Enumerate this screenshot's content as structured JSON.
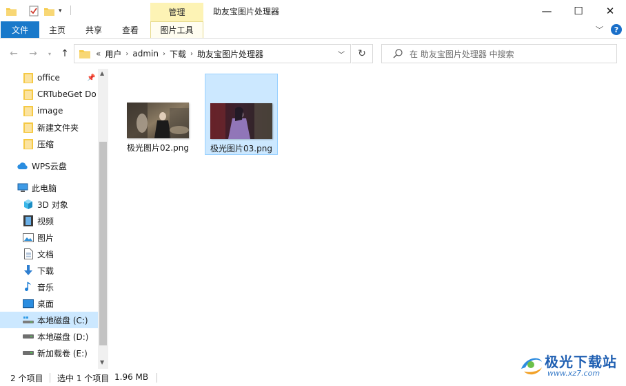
{
  "window": {
    "title": "助友宝图片处理器",
    "manage_tab": "管理",
    "controls": {
      "minimize": "—",
      "maximize": "☐",
      "close": "✕"
    }
  },
  "ribbon": {
    "tabs": [
      {
        "label": "文件"
      },
      {
        "label": "主页"
      },
      {
        "label": "共享"
      },
      {
        "label": "查看"
      },
      {
        "label": "图片工具"
      }
    ],
    "help": "?"
  },
  "address": {
    "overflow": "«",
    "crumbs": [
      "用户",
      "admin",
      "下载",
      "助友宝图片处理器"
    ],
    "separator": "›"
  },
  "search": {
    "placeholder": "在 助友宝图片处理器 中搜索"
  },
  "sidebar": {
    "quick_access": [
      {
        "label": "office",
        "icon": "folder-icon",
        "pinned": true
      },
      {
        "label": "CRTubeGet Do",
        "icon": "folder-icon"
      },
      {
        "label": "image",
        "icon": "folder-icon"
      },
      {
        "label": "新建文件夹",
        "icon": "folder-icon"
      },
      {
        "label": "压缩",
        "icon": "folder-icon"
      }
    ],
    "wps": {
      "label": "WPS云盘",
      "icon": "cloud-icon"
    },
    "this_pc": {
      "label": "此电脑",
      "icon": "computer-icon"
    },
    "pc_items": [
      {
        "label": "3D 对象",
        "icon": "cube-3d-icon"
      },
      {
        "label": "视频",
        "icon": "video-icon"
      },
      {
        "label": "图片",
        "icon": "pictures-icon"
      },
      {
        "label": "文档",
        "icon": "documents-icon"
      },
      {
        "label": "下载",
        "icon": "download-icon"
      },
      {
        "label": "音乐",
        "icon": "music-icon"
      },
      {
        "label": "桌面",
        "icon": "desktop-icon"
      },
      {
        "label": "本地磁盘 (C:)",
        "icon": "drive-c-icon",
        "selected": true
      },
      {
        "label": "本地磁盘 (D:)",
        "icon": "drive-icon"
      },
      {
        "label": "新加载卷 (E:)",
        "icon": "drive-icon"
      }
    ]
  },
  "files": [
    {
      "name": "极光图片02.png",
      "selected": false
    },
    {
      "name": "极光图片03.png",
      "selected": true
    }
  ],
  "status": {
    "count": "2 个项目",
    "selection": "选中 1 个项目",
    "size": "1.96 MB"
  },
  "watermark": {
    "text": "极光下载站",
    "url": "www.xz7.com"
  },
  "colors": {
    "accent": "#1979ca",
    "selection": "#cce8ff",
    "manage_tab": "#fdf3b5",
    "folder": "#f5c944"
  }
}
